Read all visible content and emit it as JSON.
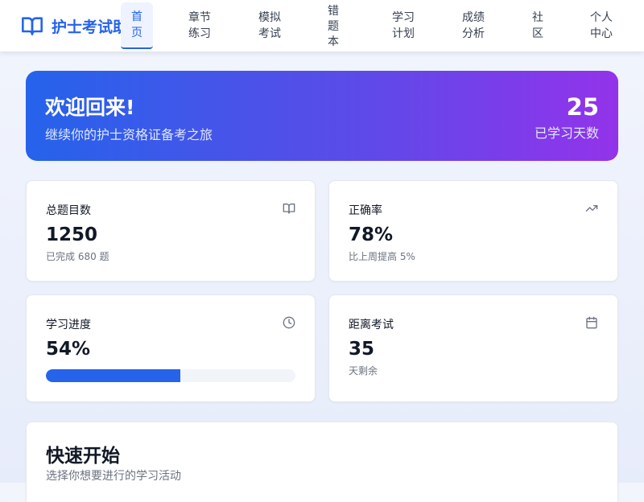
{
  "app": {
    "title": "护士考试助手",
    "brand_color": "#2563eb"
  },
  "nav": [
    {
      "lines": [
        "首",
        "页"
      ],
      "active": true
    },
    {
      "lines": [
        "章节",
        "练习"
      ],
      "active": false
    },
    {
      "lines": [
        "模拟",
        "考试"
      ],
      "active": false
    },
    {
      "lines": [
        "错",
        "题",
        "本"
      ],
      "active": false
    },
    {
      "lines": [
        "学习",
        "计划"
      ],
      "active": false
    },
    {
      "lines": [
        "成绩",
        "分析"
      ],
      "active": false
    },
    {
      "lines": [
        "社",
        "区"
      ],
      "active": false
    },
    {
      "lines": [
        "个人",
        "中心"
      ],
      "active": false
    }
  ],
  "hero": {
    "title": "欢迎回来!",
    "subtitle": "继续你的护士资格证备考之旅",
    "days_value": "25",
    "days_label": "已学习天数",
    "gradient_from": "#2563eb",
    "gradient_to": "#9333ea"
  },
  "stats": {
    "total": {
      "label": "总题目数",
      "value": "1250",
      "note": "已完成 680 题",
      "icon": "book-open-icon"
    },
    "accuracy": {
      "label": "正确率",
      "value": "78%",
      "note": "比上周提高 5%",
      "icon": "trending-up-icon"
    },
    "progress": {
      "label": "学习进度",
      "value": "54%",
      "percent": 54,
      "icon": "clock-icon"
    },
    "exam": {
      "label": "距离考试",
      "value": "35",
      "note": "天剩余",
      "icon": "calendar-icon"
    }
  },
  "quick_start": {
    "title": "快速开始",
    "subtitle": "选择你想要进行的学习活动"
  }
}
